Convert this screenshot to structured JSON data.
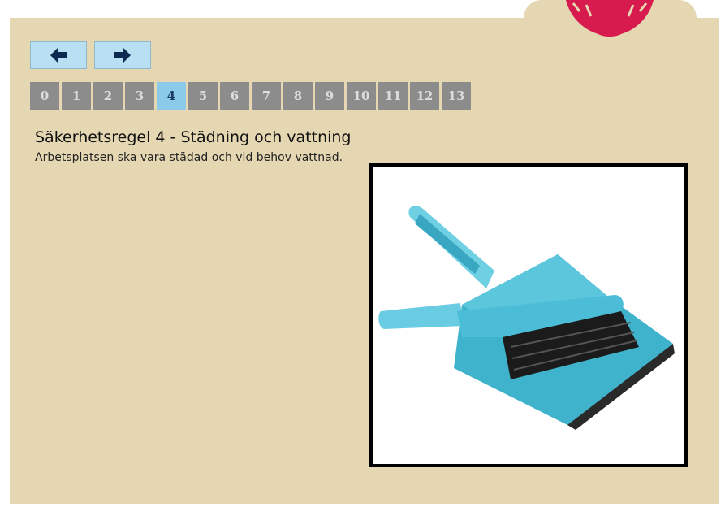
{
  "navigation": {
    "prev_icon": "arrow-left-icon",
    "next_icon": "arrow-right-icon"
  },
  "pager": {
    "pages": [
      "0",
      "1",
      "2",
      "3",
      "4",
      "5",
      "6",
      "7",
      "8",
      "9",
      "10",
      "11",
      "12",
      "13"
    ],
    "active": "4"
  },
  "content": {
    "title": "Säkerhetsregel 4 - Städning och vattning",
    "description": "Arbetsplatsen ska vara städad och vid behov vattnad."
  },
  "colors": {
    "panel": "#e4d7b2",
    "nav_button": "#b9dff3",
    "page_button": "#8c8c8c",
    "page_button_active": "#8ccaea",
    "logo": "#d81b4f"
  }
}
